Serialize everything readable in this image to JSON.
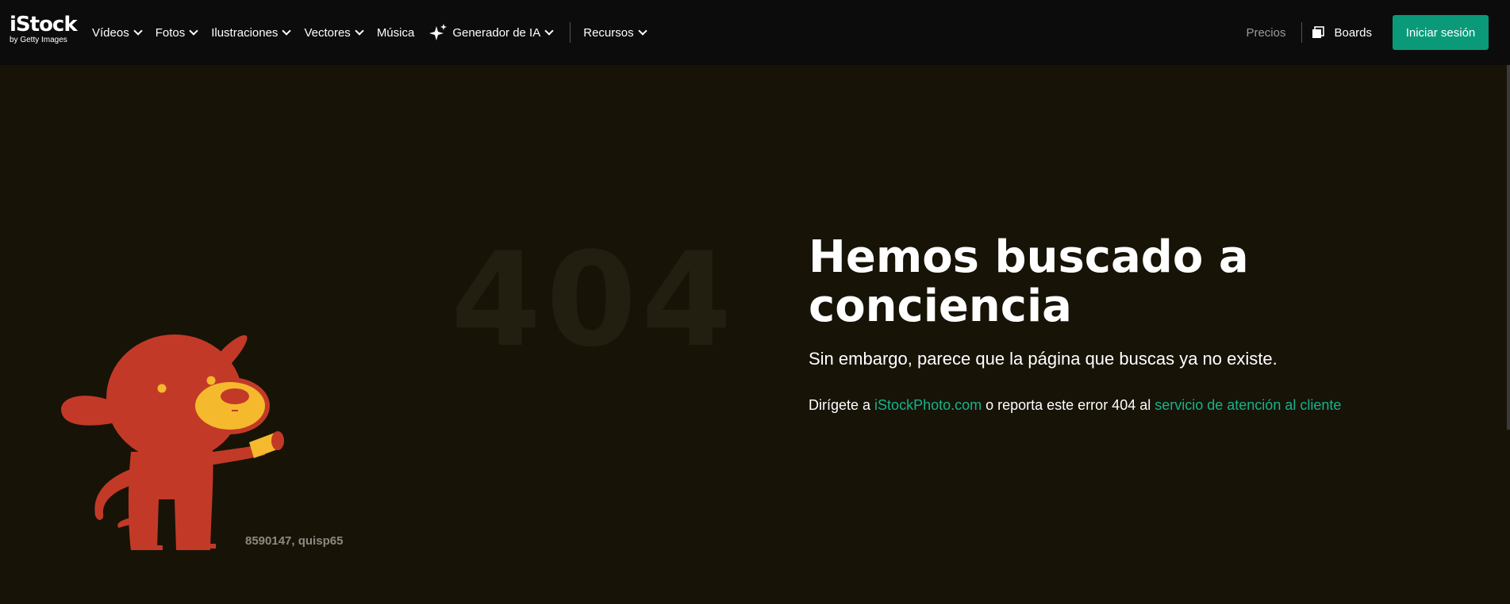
{
  "header": {
    "logo": {
      "main": "iStock",
      "sub": "by Getty Images"
    },
    "nav": [
      {
        "label": "Vídeos",
        "has_dropdown": true
      },
      {
        "label": "Fotos",
        "has_dropdown": true
      },
      {
        "label": "Ilustraciones",
        "has_dropdown": true
      },
      {
        "label": "Vectores",
        "has_dropdown": true
      },
      {
        "label": "Música",
        "has_dropdown": false
      },
      {
        "label": "Generador de IA",
        "has_dropdown": true,
        "icon": "sparkle-icon"
      },
      {
        "label": "Recursos",
        "has_dropdown": true
      }
    ],
    "pricing_label": "Precios",
    "boards_label": "Boards",
    "signin_label": "Iniciar sesión"
  },
  "error": {
    "code": "404",
    "heading": "Hemos buscado a conciencia",
    "subtitle": "Sin embargo, parece que la página que buscas ya no existe.",
    "message_prefix": "Dirígete a ",
    "home_link": "iStockPhoto.com",
    "message_middle": " o reporta este error 404 al ",
    "support_link": "servicio de atención al cliente",
    "image_credit": "8590147, quisp65"
  },
  "colors": {
    "background": "#171307",
    "topbar": "#0c0c0c",
    "accent": "#0a9a7a",
    "link": "#14b38c",
    "dog_body": "#c23a27",
    "dog_muzzle": "#f5b92e"
  }
}
